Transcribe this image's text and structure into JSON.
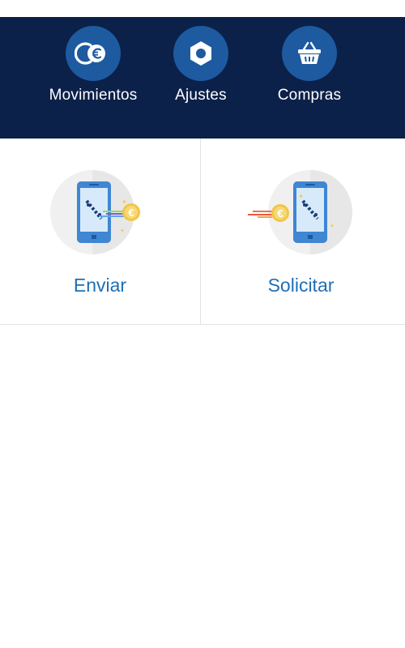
{
  "nav": {
    "items": [
      {
        "label": "Movimientos",
        "icon": "euro-coin-icon"
      },
      {
        "label": "Ajustes",
        "icon": "hexagon-nut-icon"
      },
      {
        "label": "Compras",
        "icon": "shopping-basket-icon"
      }
    ]
  },
  "actions": [
    {
      "label": "Enviar",
      "icon": "send-money-phone-icon"
    },
    {
      "label": "Solicitar",
      "icon": "request-money-phone-icon"
    }
  ],
  "colors": {
    "header_bg": "#0b2149",
    "icon_circle": "#1d5aa0",
    "action_text": "#1f6eb6",
    "divider": "#e2e2e2"
  }
}
